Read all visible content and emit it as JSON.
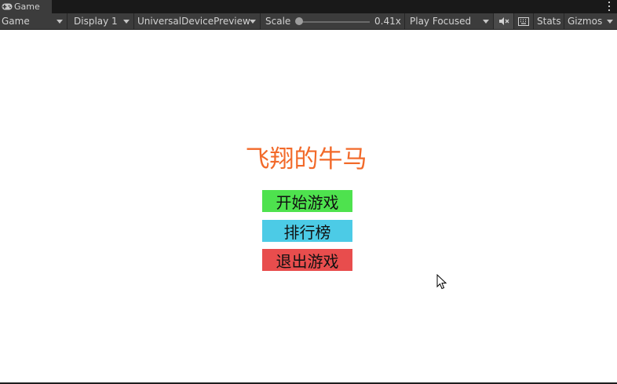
{
  "tab": {
    "label": "Game",
    "icon": "gamepad-icon"
  },
  "toolbar": {
    "mode": "Game",
    "display": "Display 1",
    "device": "UniversalDevicePreview",
    "scale_label": "Scale",
    "scale_value": "0.41x",
    "play_mode": "Play Focused",
    "stats": "Stats",
    "gizmos": "Gizmos"
  },
  "game": {
    "title": "飞翔的牛马",
    "buttons": {
      "start": "开始游戏",
      "leaderboard": "排行榜",
      "quit": "退出游戏"
    }
  },
  "colors": {
    "title": "#f26a2a",
    "start": "#4ee24e",
    "leaderboard": "#4ccbe6",
    "quit": "#e84d4d"
  }
}
